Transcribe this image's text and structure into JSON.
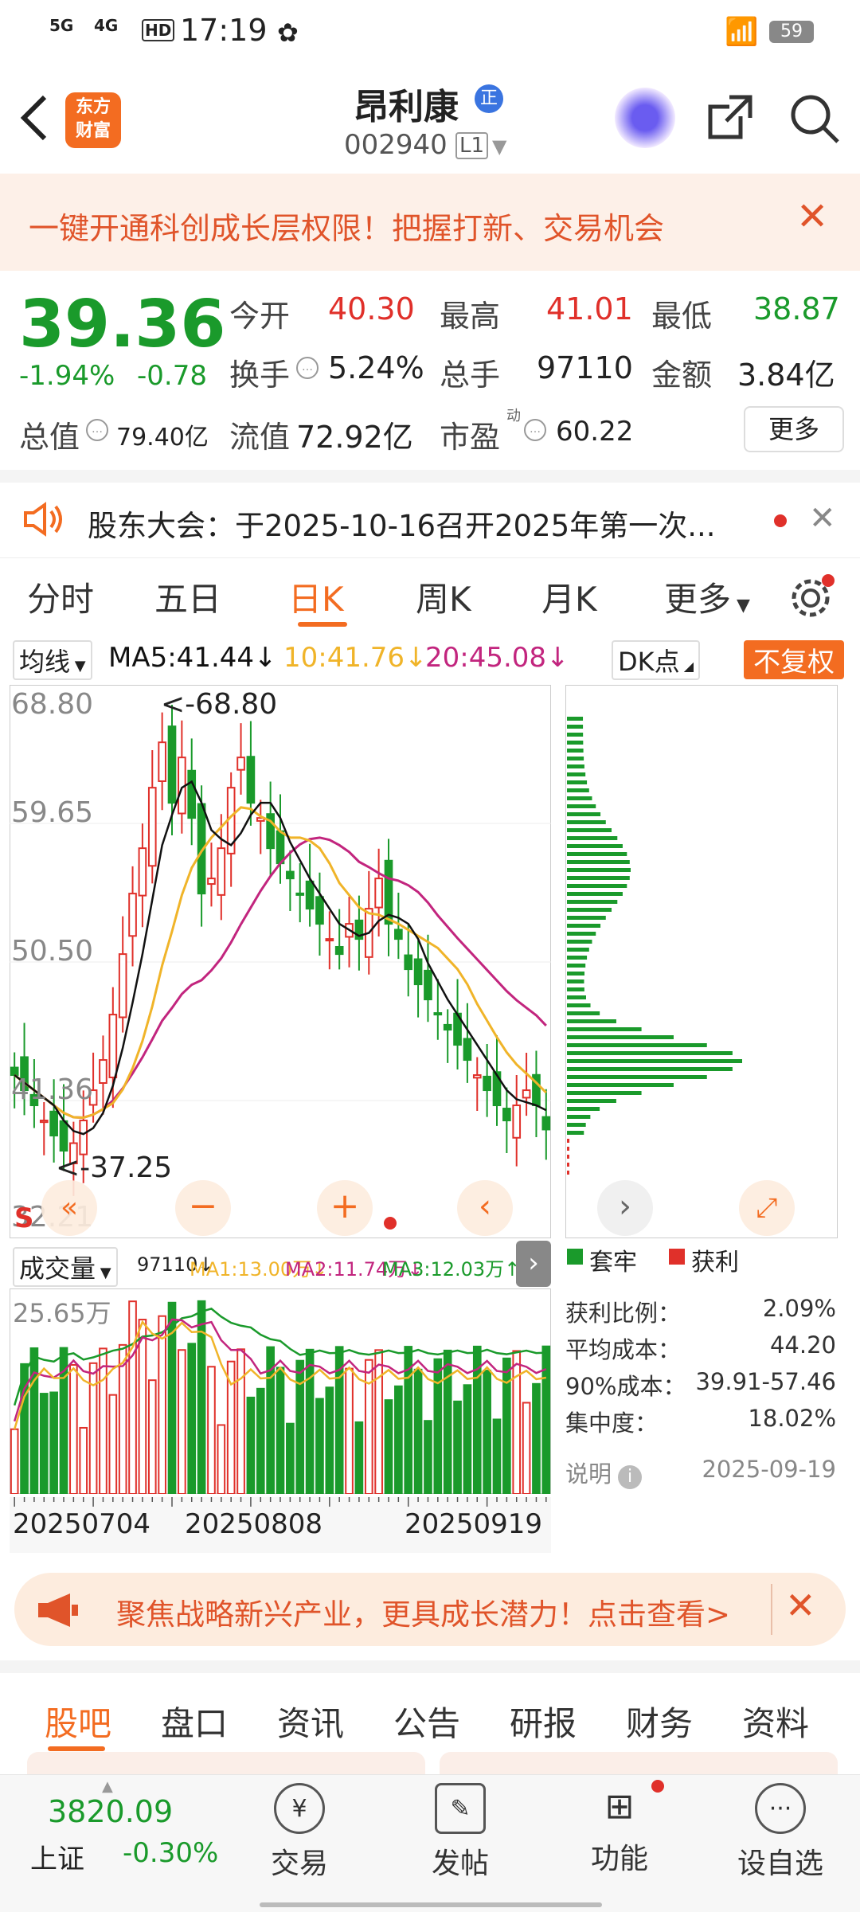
{
  "status": {
    "time": "17:19",
    "net1": "5G",
    "net2": "4G",
    "hd": "HD",
    "battery": "59"
  },
  "header": {
    "logo_line1": "东方",
    "logo_line2": "财富",
    "stock_name": "昂利康",
    "stock_code": "002940",
    "level_badge": "L1",
    "name_badge": "正"
  },
  "promo": {
    "text": "一键开通科创成长层权限！把握打新、交易机会"
  },
  "quote": {
    "price": "39.36",
    "change_pct": "-1.94%",
    "change": "-0.78",
    "open_label": "今开",
    "open": "40.30",
    "high_label": "最高",
    "high": "41.01",
    "low_label": "最低",
    "low": "38.87",
    "turnover_label": "换手",
    "turnover": "5.24%",
    "volume_label": "总手",
    "volume": "97110",
    "amount_label": "金额",
    "amount": "3.84亿",
    "mktcap_label": "总值",
    "mktcap": "79.40亿",
    "float_label": "流值",
    "float": "72.92亿",
    "pe_label": "市盈",
    "pe_sup": "动",
    "pe": "60.22",
    "more_btn": "更多"
  },
  "notice": {
    "text": "股东大会：于2025-10-16召开2025年第一次..."
  },
  "ktabs": {
    "t1": "分时",
    "t2": "五日",
    "t3": "日K",
    "t4": "周K",
    "t5": "月K",
    "t6": "更多"
  },
  "ma": {
    "selector": "均线",
    "ma5": "MA5:41.44",
    "ma10": "10:41.76",
    "ma20": "20:45.08",
    "dk": "DK点",
    "fq": "不复权"
  },
  "kchart": {
    "y1": "68.80",
    "y2": "59.65",
    "y3": "50.50",
    "y4": "41.36",
    "y5": "32.21",
    "hi_label": "<-68.80",
    "lo_label": "<-37.25",
    "s_label": "S"
  },
  "vol": {
    "selector": "成交量",
    "v": "97110",
    "ma1": "MA1:13.00万",
    "ma2": "MA2:11.74万",
    "ma3": "MA3:12.03万",
    "max_label": "25.65万",
    "x1": "20250704",
    "x2": "20250808",
    "x3": "20250919"
  },
  "chip": {
    "legend1": "套牢",
    "legend2": "获利",
    "r1_label": "获利比例：",
    "r1": "2.09%",
    "r2_label": "平均成本：",
    "r2": "44.20",
    "r3_label": "90%成本：",
    "r3": "39.91-57.46",
    "r4_label": "集中度：",
    "r4": "18.02%",
    "note_label": "说明",
    "date": "2025-09-19"
  },
  "ad": {
    "text": "聚焦战略新兴产业，更具成长潜力！点击查看>"
  },
  "btabs": {
    "b1": "股吧",
    "b2": "盘口",
    "b3": "资讯",
    "b4": "公告",
    "b5": "研报",
    "b6": "财务",
    "b7": "资料"
  },
  "bnav": {
    "index_value": "3820.09",
    "index_name": "上证",
    "index_change": "-0.30%",
    "n1": "交易",
    "n2": "发帖",
    "n3": "功能",
    "n4": "设自选"
  },
  "colors": {
    "up": "#e0302a",
    "down": "#1a9a2b",
    "accent": "#f36c21",
    "ma5": "#111111",
    "ma10": "#f0b429",
    "ma20": "#c2257e"
  }
}
